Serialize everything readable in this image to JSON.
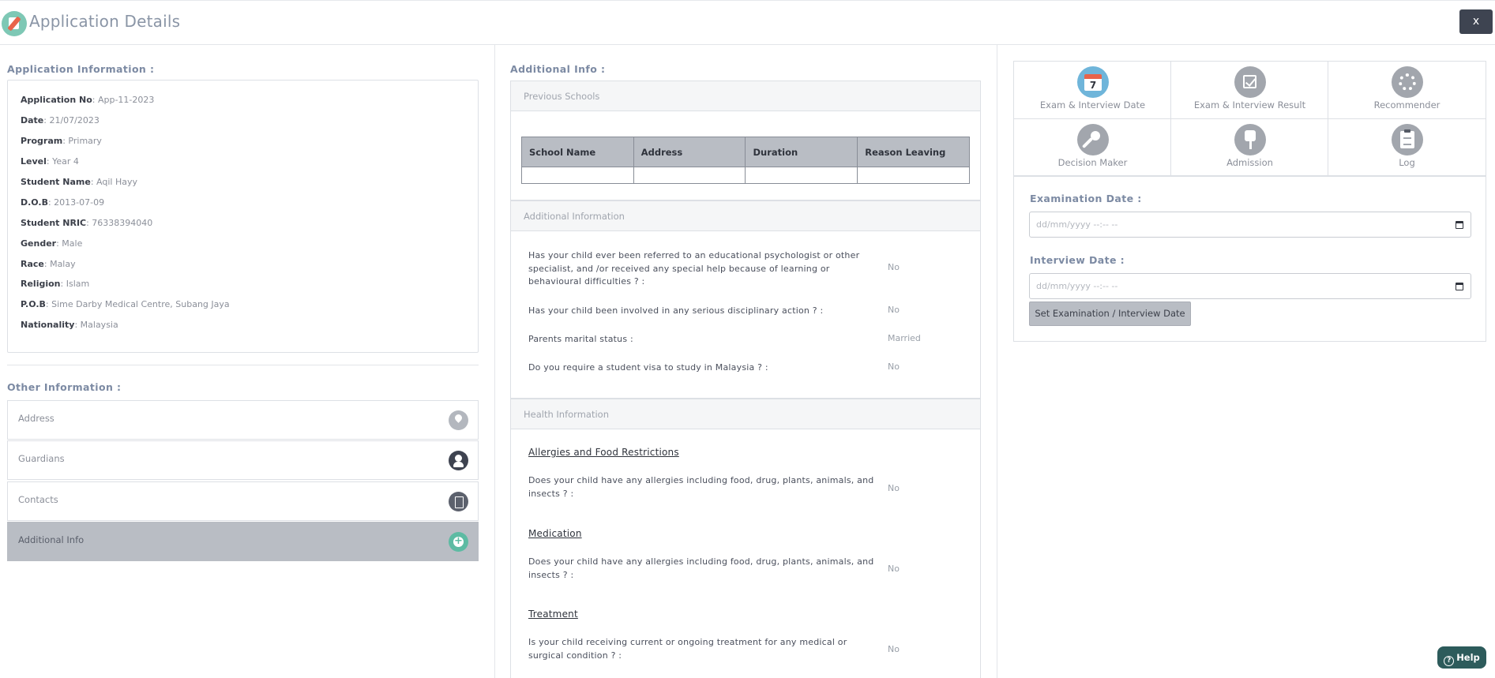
{
  "header": {
    "title": "Application Details",
    "close_label": "x"
  },
  "left": {
    "app_info_title": "Application Information :",
    "fields": [
      {
        "label": "Application No",
        "value": ": App-11-2023"
      },
      {
        "label": "Date",
        "value": ": 21/07/2023"
      },
      {
        "label": "Program",
        "value": ": Primary"
      },
      {
        "label": "Level",
        "value": ": Year 4"
      },
      {
        "label": "Student Name",
        "value": ": Aqil Hayy"
      },
      {
        "label": "D.O.B",
        "value": ": 2013-07-09"
      },
      {
        "label": "Student NRIC",
        "value": ": 76338394040"
      },
      {
        "label": "Gender",
        "value": ": Male"
      },
      {
        "label": "Race",
        "value": ": Malay"
      },
      {
        "label": "Religion",
        "value": ": Islam"
      },
      {
        "label": "P.O.B",
        "value": ": Sime Darby Medical Centre, Subang Jaya"
      },
      {
        "label": "Nationality",
        "value": ": Malaysia"
      }
    ],
    "other_info_title": "Other Information :",
    "accordion": [
      {
        "label": "Address",
        "icon": "location-pin-icon"
      },
      {
        "label": "Guardians",
        "icon": "person-icon"
      },
      {
        "label": "Contacts",
        "icon": "contact-book-icon"
      },
      {
        "label": "Additional Info",
        "icon": "add-circle-icon"
      }
    ]
  },
  "middle": {
    "title": "Additional Info :",
    "previous_schools": {
      "heading": "Previous Schools",
      "columns": [
        "School Name",
        "Address",
        "Duration",
        "Reason Leaving"
      ]
    },
    "additional_information": {
      "heading": "Additional Information",
      "items": [
        {
          "question": "Has your child ever been referred to an educational psychologist or other specialist, and /or received any special help because of learning or behavioural difficulties ? :",
          "answer": "No"
        },
        {
          "question": "Has your child been involved in any serious disciplinary action ? :",
          "answer": "No"
        },
        {
          "question": "Parents marital status :",
          "answer": "Married"
        },
        {
          "question": "Do you require a student visa to study in Malaysia ? :",
          "answer": "No"
        }
      ]
    },
    "health_information": {
      "heading": "Health Information",
      "sections": [
        {
          "title": "Allergies and Food Restrictions",
          "question": "Does your child have any allergies including food, drug, plants, animals, and insects ? :",
          "answer": "No"
        },
        {
          "title": "Medication",
          "question": "Does your child have any allergies including food, drug, plants, animals, and insects ? :",
          "answer": "No"
        },
        {
          "title": "Treatment",
          "question": "Is your child receiving current or ongoing treatment for any medical or surgical condition ? :",
          "answer": "No"
        }
      ]
    }
  },
  "right": {
    "tabs": [
      {
        "label": "Exam & Interview Date",
        "icon": "calendar-icon",
        "calendar_day": "7"
      },
      {
        "label": "Exam & Interview Result",
        "icon": "checkbox-icon"
      },
      {
        "label": "Recommender",
        "icon": "spinner-icon"
      },
      {
        "label": "Decision Maker",
        "icon": "key-icon"
      },
      {
        "label": "Admission",
        "icon": "pushpin-icon"
      },
      {
        "label": "Log",
        "icon": "clipboard-icon"
      }
    ],
    "exam_date_label": "Examination Date :",
    "exam_date_placeholder": "dd/mm/yyyy --:-- --",
    "interview_date_label": "Interview Date :",
    "interview_date_placeholder": "dd/mm/yyyy --:-- --",
    "set_button_label": "Set Examination / Interview Date"
  },
  "help": {
    "label": "Help"
  },
  "colors": {
    "accent": "#7c8aa3",
    "active_item": "#b9bdc4",
    "help_bg": "#2d5b5b",
    "close_bg": "#3e4451"
  }
}
